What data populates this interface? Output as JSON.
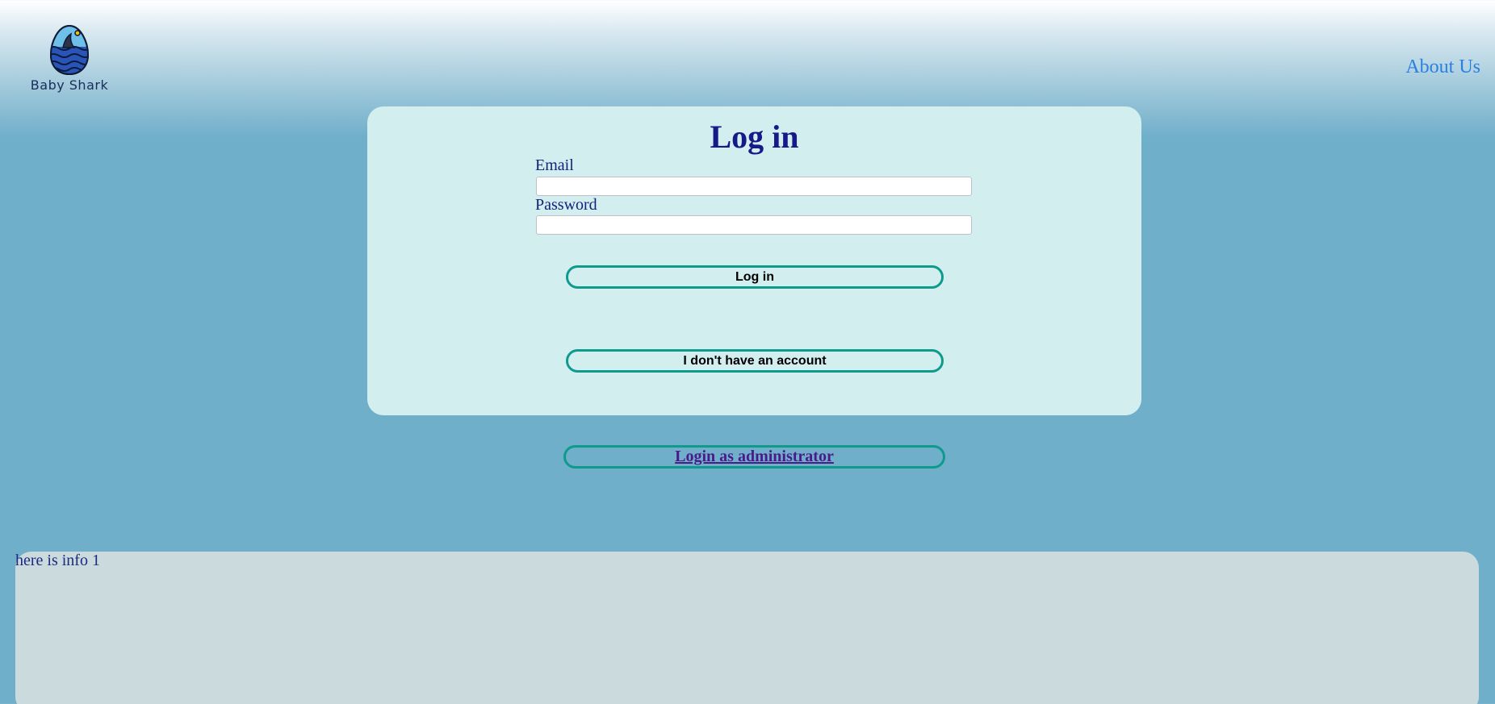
{
  "header": {
    "brand_name": "Baby Shark",
    "logo_icon": "shark-fin-egg-icon",
    "nav_about": "About Us"
  },
  "login": {
    "title": "Log in",
    "email_label": "Email",
    "email_value": "",
    "password_label": "Password",
    "password_value": "",
    "login_button": "Log in",
    "no_account_button": "I don't have an account"
  },
  "admin": {
    "link_label": "Login as administrator"
  },
  "info": {
    "text": "here is info 1"
  },
  "colors": {
    "title": "#151a88",
    "link": "#2a7fe0",
    "button_border": "#0f9a8e",
    "panel": "#d2eeef",
    "info_panel": "#cbdadd",
    "background": "#70afca"
  }
}
